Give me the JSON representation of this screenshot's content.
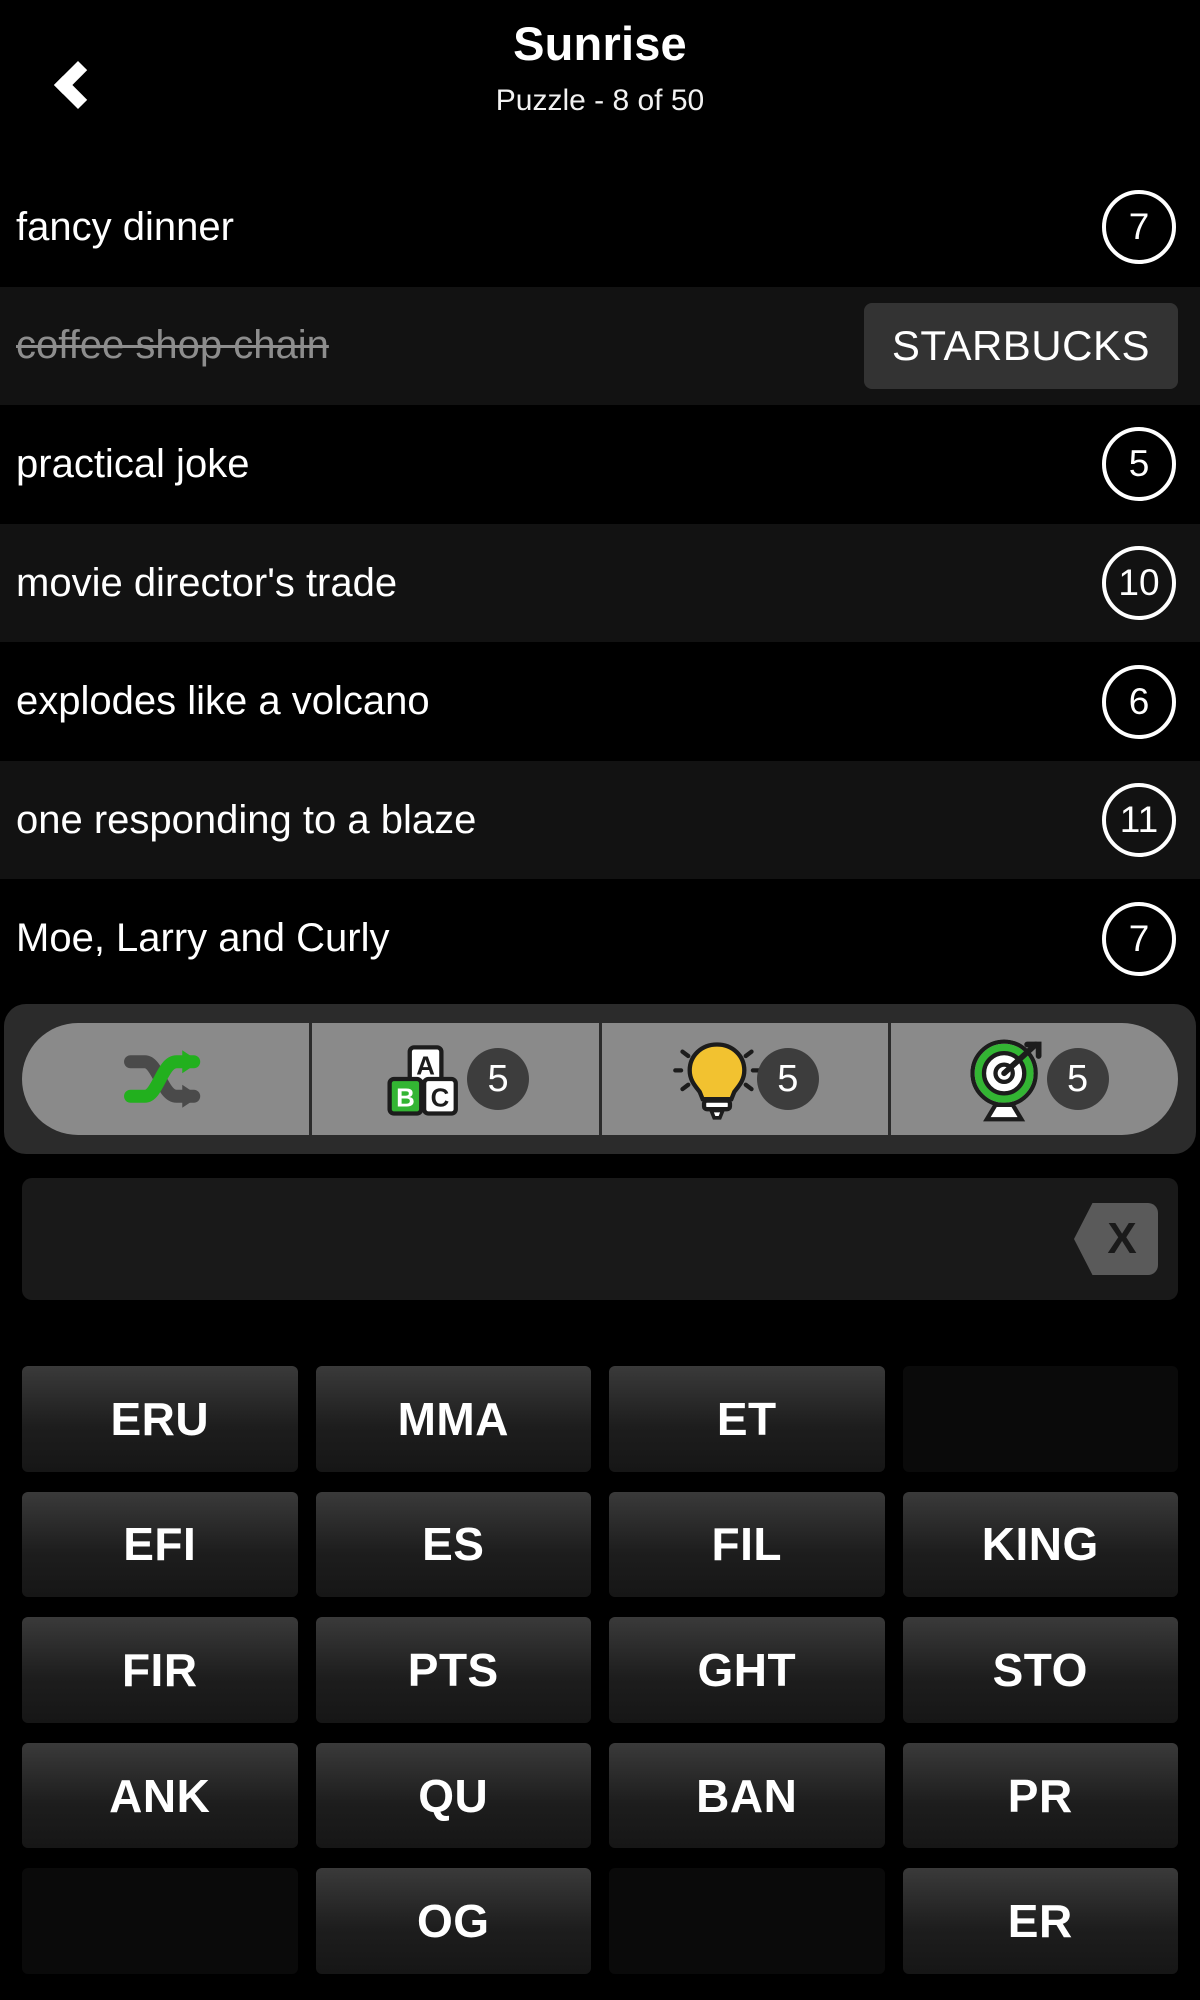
{
  "header": {
    "back_icon": "chevron-left-icon",
    "title": "Sunrise",
    "subtitle": "Puzzle - 8 of 50"
  },
  "clues": [
    {
      "text": "fancy dinner",
      "length": "7",
      "solved": false,
      "answer": ""
    },
    {
      "text": "coffee shop chain",
      "length": "9",
      "solved": true,
      "answer": "STARBUCKS"
    },
    {
      "text": "practical joke",
      "length": "5",
      "solved": false,
      "answer": ""
    },
    {
      "text": "movie director's trade",
      "length": "10",
      "solved": false,
      "answer": ""
    },
    {
      "text": "explodes like a volcano",
      "length": "6",
      "solved": false,
      "answer": ""
    },
    {
      "text": "one responding to a blaze",
      "length": "11",
      "solved": false,
      "answer": ""
    },
    {
      "text": "Moe, Larry and Curly",
      "length": "7",
      "solved": false,
      "answer": ""
    }
  ],
  "powerups": [
    {
      "name": "shuffle",
      "icon": "shuffle-icon",
      "count": ""
    },
    {
      "name": "add-letter",
      "icon": "letter-blocks-icon",
      "count": "5"
    },
    {
      "name": "hint",
      "icon": "lightbulb-icon",
      "count": "5"
    },
    {
      "name": "reveal",
      "icon": "target-icon",
      "count": "5"
    }
  ],
  "answer_input": {
    "value": "",
    "placeholder": "",
    "delete_icon": "backspace-delete-icon",
    "delete_label": "X"
  },
  "tiles": [
    "ERU",
    "MMA",
    "ET",
    "",
    "EFI",
    "ES",
    "FIL",
    "KING",
    "FIR",
    "PTS",
    "GHT",
    "STO",
    "ANK",
    "QU",
    "BAN",
    "PR",
    "",
    "OG",
    "",
    "ER"
  ],
  "colors": {
    "background": "#000000",
    "row_alt": "#121212",
    "accent_green": "#22b01e",
    "chip_gray": "#333333",
    "powerbar_gray": "#8a8a8a",
    "bulb_yellow": "#f2c230"
  }
}
